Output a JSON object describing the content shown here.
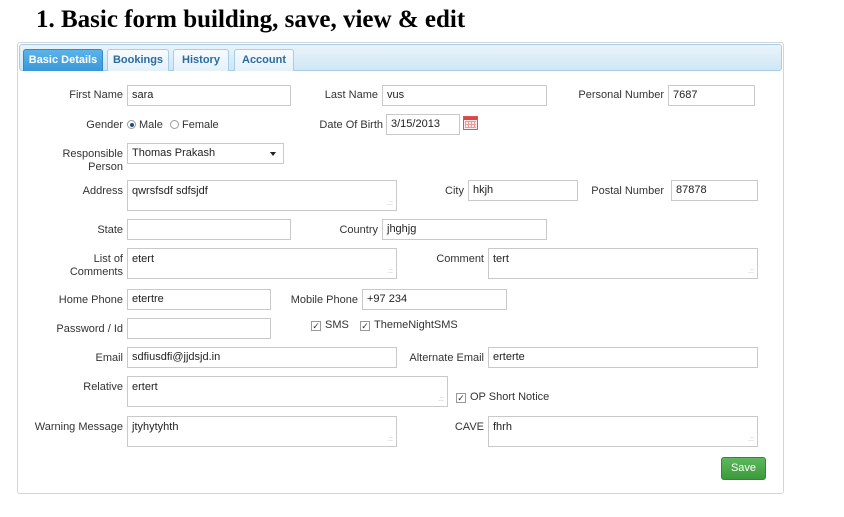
{
  "page": {
    "heading": "1. Basic form building, save, view & edit"
  },
  "tabs": [
    {
      "label": "Basic Details",
      "active": true
    },
    {
      "label": "Bookings",
      "active": false
    },
    {
      "label": "History",
      "active": false
    },
    {
      "label": "Account",
      "active": false
    }
  ],
  "form": {
    "first_name": {
      "label": "First Name",
      "value": "sara"
    },
    "last_name": {
      "label": "Last Name",
      "value": "vus"
    },
    "personal_number": {
      "label": "Personal Number",
      "value": "7687"
    },
    "gender": {
      "label": "Gender",
      "options": [
        "Male",
        "Female"
      ],
      "selected": "Male"
    },
    "date_of_birth": {
      "label": "Date Of Birth",
      "value": "3/15/2013"
    },
    "responsible_person": {
      "label_line1": "Responsible",
      "label_line2": "Person",
      "value": "Thomas Prakash"
    },
    "address": {
      "label": "Address",
      "value": "qwrsfsdf sdfsjdf"
    },
    "city": {
      "label": "City",
      "value": "hkjh"
    },
    "postal_number": {
      "label": "Postal Number",
      "value": "87878"
    },
    "state": {
      "label": "State",
      "value": ""
    },
    "country": {
      "label": "Country",
      "value": "jhghjg"
    },
    "list_of_comments": {
      "label_line1": "List of",
      "label_line2": "Comments",
      "value": "etert"
    },
    "comment": {
      "label": "Comment",
      "value": "tert"
    },
    "home_phone": {
      "label": "Home Phone",
      "value": "etertre"
    },
    "mobile_phone": {
      "label": "Mobile Phone",
      "value": "+97 234"
    },
    "password_id": {
      "label": "Password / Id",
      "value": ""
    },
    "sms": {
      "label": "SMS",
      "checked": true
    },
    "theme_night_sms": {
      "label": "ThemeNightSMS",
      "checked": true
    },
    "email": {
      "label": "Email",
      "value": "sdfiusdfi@jjdsjd.in"
    },
    "alternate_email": {
      "label": "Alternate Email",
      "value": "erterte"
    },
    "relative": {
      "label": "Relative",
      "value": "ertert"
    },
    "op_short_notice": {
      "label": "OP Short Notice",
      "checked": true
    },
    "warning_message": {
      "label": "Warning Message",
      "value": "jtyhytyhth"
    },
    "cave": {
      "label": "CAVE",
      "value": "fhrh"
    },
    "save_label": "Save"
  },
  "colors": {
    "tab_active": "#3a98d8",
    "tab_text": "#2b6ba0",
    "save_button": "#4aa84a"
  },
  "icons": {
    "calendar": "calendar-icon",
    "dropdown": "chevron-down-icon",
    "resize": "resize-grip-icon"
  }
}
